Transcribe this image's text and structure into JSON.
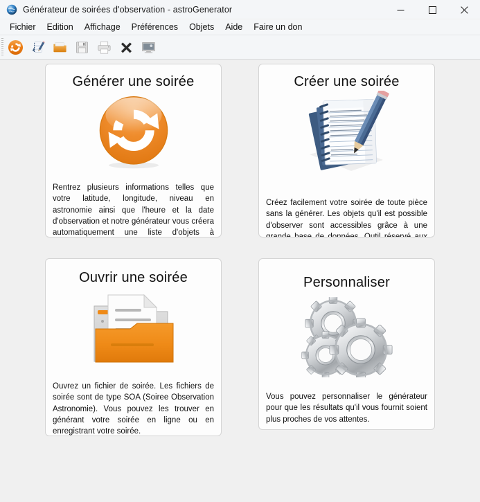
{
  "window": {
    "title": "Générateur de soirées d'observation - astroGenerator",
    "app_icon": "globe-icon",
    "controls": {
      "minimize": "minimize-icon",
      "maximize": "maximize-icon",
      "close": "close-icon"
    }
  },
  "menubar": {
    "items": [
      {
        "label": "Fichier"
      },
      {
        "label": "Edition"
      },
      {
        "label": "Affichage"
      },
      {
        "label": "Préférences"
      },
      {
        "label": "Objets"
      },
      {
        "label": "Aide"
      },
      {
        "label": "Faire un don"
      }
    ]
  },
  "toolbar": {
    "buttons": [
      {
        "icon": "generate-refresh-icon"
      },
      {
        "icon": "notepad-pencil-icon"
      },
      {
        "icon": "open-folder-icon"
      },
      {
        "icon": "save-floppy-icon"
      },
      {
        "icon": "print-icon"
      },
      {
        "icon": "delete-cross-icon"
      },
      {
        "icon": "screen-monitor-icon"
      }
    ]
  },
  "cards": [
    {
      "id": "generate",
      "title": "Générer une soirée",
      "icon": "generate-refresh-icon",
      "description": "Rentrez plusieurs informations telles que votre latitude, longitude, niveau en astronomie ainsi que l'heure et la date d'observation et notre générateur vous créera automatiquement une liste d'objets à observer pour la soirée."
    },
    {
      "id": "create",
      "title": "Créer une soirée",
      "icon": "notepad-pencil-icon",
      "description": "Créez facilement votre soirée de toute pièce sans la générer. Les objets qu'il est possible d'observer sont accessibles grâce à une grande base de données. Outil réservé aux astronomes confirmés."
    },
    {
      "id": "open",
      "title": "Ouvrir une soirée",
      "icon": "open-folder-icon",
      "description": "Ouvrez un fichier de soirée. Les fichiers de soirée sont de type SOA (Soiree Observation Astronomie). Vous pouvez les trouver en générant votre soirée en ligne ou en enregistrant votre soirée."
    },
    {
      "id": "customize",
      "title": "Personnaliser",
      "icon": "gears-icon",
      "description": "Vous pouvez personnaliser le générateur pour que les résultats qu'il vous fournit soient plus proches de vos attentes."
    }
  ],
  "colors": {
    "accent_orange": "#e8821e",
    "window_chrome": "#f4f6f8",
    "content_background": "#f0f0f0",
    "card_background": "#fdfdfd",
    "card_border": "#d4d4d4"
  }
}
